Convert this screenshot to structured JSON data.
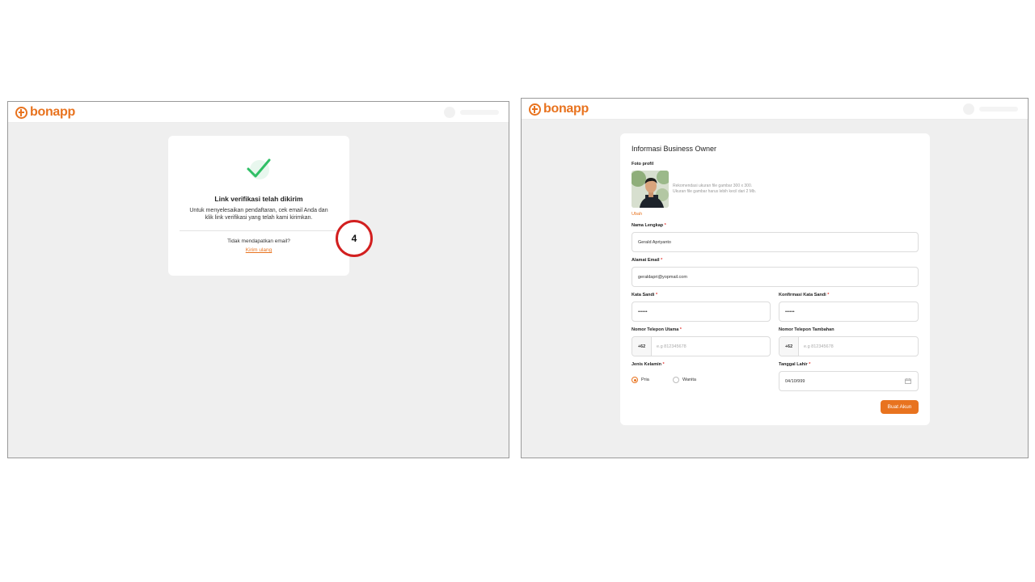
{
  "brand": {
    "name_light": "bon",
    "name_bold": "app",
    "color": "#e8731f"
  },
  "verify": {
    "title": "Link verifikasi telah dikirim",
    "desc_line1": "Untuk menyelesaikan pendaftaran, cek email Anda dan",
    "desc_line2": "klik link verifikasi yang telah kami kirimkan.",
    "question": "Tidak mendapatkan email?",
    "resend": "Kirim ulang"
  },
  "step_badge": "4",
  "form": {
    "title": "Informasi Business Owner",
    "photo_label": "Foto profil",
    "photo_hint_line1": "Rekomendasi ukuran file gambar 300 x 300.",
    "photo_hint_line2": "Ukuran file gambar harus lebih kecil dari 2 Mb.",
    "change_photo": "Ubah",
    "required_mark": "*",
    "name": {
      "label": "Nama Lengkap",
      "value": "Gerald Apriyanto"
    },
    "email": {
      "label": "Alamat Email",
      "value": "geraldapri@yopmail.com"
    },
    "password": {
      "label": "Kata Sandi",
      "value": "••••••"
    },
    "confirm_password": {
      "label": "Konfirmasi Kata Sandi",
      "value": "••••••"
    },
    "phone_main": {
      "label": "Nomor Telepon Utama",
      "prefix": "+62",
      "placeholder": "e.g 812345678"
    },
    "phone_extra": {
      "label": "Nomor Telepon Tambahan",
      "prefix": "+62",
      "placeholder": "e.g 812345678"
    },
    "gender": {
      "label": "Jenis Kelamin",
      "options": [
        "Pria",
        "Wanita"
      ],
      "selected": "Pria"
    },
    "birthdate": {
      "label": "Tanggal Lahir",
      "value": "04/10/999"
    },
    "submit": "Buat Akun"
  }
}
